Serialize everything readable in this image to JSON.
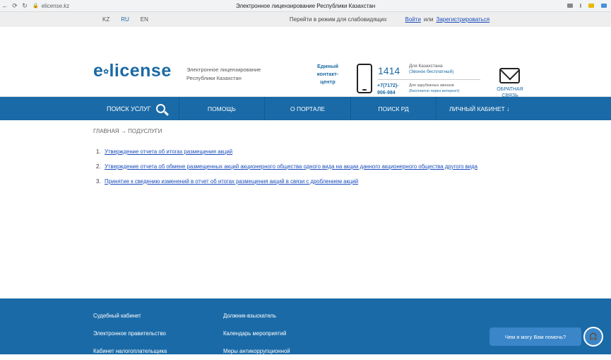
{
  "browser": {
    "back": "←",
    "history": "⟳",
    "reload": "↻",
    "url": "elicense.kz",
    "lock": "🔒",
    "title": "Электронное лицензирование Республики Казахстан"
  },
  "topbar": {
    "languages": [
      "KZ",
      "RU",
      "EN"
    ],
    "accessibility": "Перейти в режим для слабовидящих",
    "login": "Войти",
    "or": "или",
    "register": "Зарегистрироваться"
  },
  "header": {
    "logo_e": "e",
    "logo_rest": "license",
    "desc_line1": "Электронное лицензирование",
    "desc_line2": "Республики Казахстан",
    "contact_l1": "Единый",
    "contact_l2": "контакт-",
    "contact_l3": "центр",
    "hotline": "1414",
    "hotline_note1": "Для Казахстана",
    "hotline_note2": "(Звонок бесплатный)",
    "phone2_l1": "+7(7172)-",
    "phone2_l2": "906-984",
    "phone2_note1": "Для зарубежных звонков",
    "phone2_note2": "(Бесплатно через интернет)",
    "feedback_l1": "ОБРАТНАЯ",
    "feedback_l2": "СВЯЗЬ"
  },
  "nav": {
    "items": [
      "ПОИСК УСЛУГ",
      "ПОМОЩЬ",
      "О ПОРТАЛЕ",
      "ПОИСК РД",
      "ЛИЧНЫЙ КАБИНЕТ ↓"
    ]
  },
  "breadcrumb": "ГЛАВНАЯ → ПОДУСЛУГИ",
  "list": [
    {
      "num": "1.",
      "text": "Утверждение отчета об итогах размещения акций"
    },
    {
      "num": "2.",
      "text": "Утверждение отчета об обмене размещенных акций акционерного общества одного вида на акции данного акционерного общества другого вида"
    },
    {
      "num": "3.",
      "text": "Принятие к сведению изменений в отчет об итогах размещения акций в связи с дроблением акций"
    }
  ],
  "footer": {
    "col1": [
      "Судебный кабинет",
      "Электронное правительство",
      "Кабинет налогоплательщика"
    ],
    "col2": [
      "Должник-взыскатель",
      "Календарь мероприятий",
      "Меры антикоррупционной"
    ]
  },
  "chat": {
    "label": "Чем я могу Вам помочь?",
    "icon_text": "🎧"
  },
  "colors": {
    "brand": "#1a6aa7",
    "link": "#1a4dbd"
  }
}
